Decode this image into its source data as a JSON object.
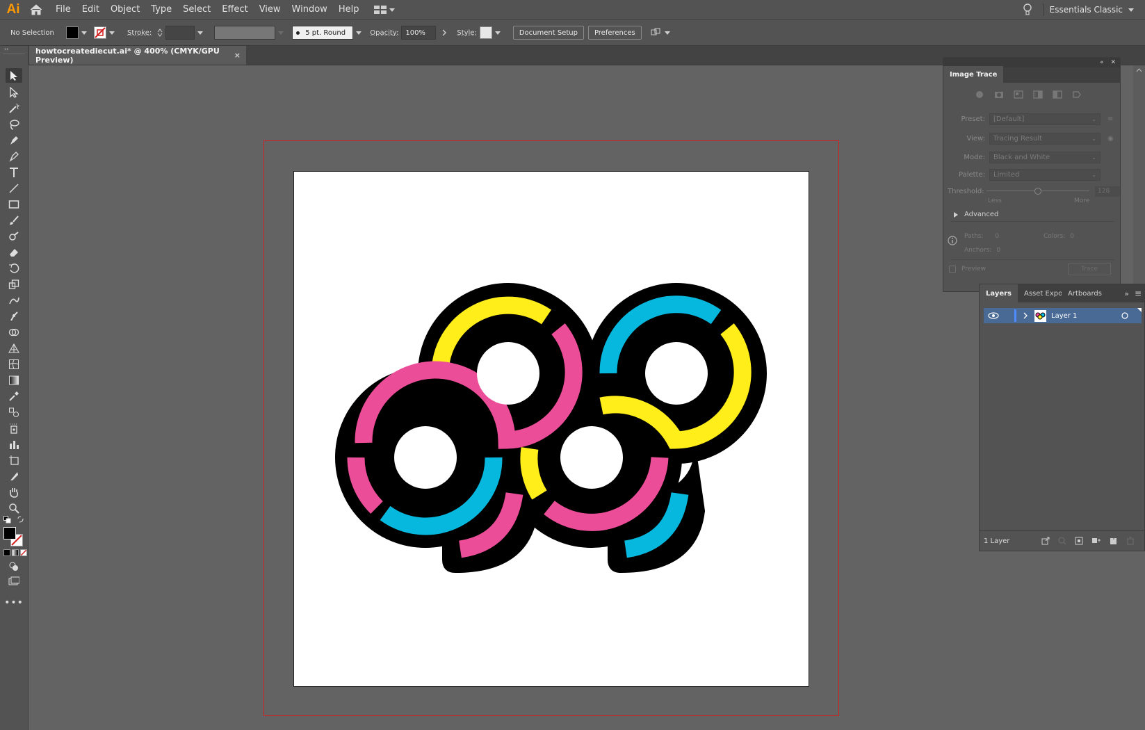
{
  "app": {
    "logo": "Ai",
    "workspace": "Essentials Classic"
  },
  "menu": [
    "File",
    "Edit",
    "Object",
    "Type",
    "Select",
    "Effect",
    "View",
    "Window",
    "Help"
  ],
  "control": {
    "selection": "No Selection",
    "stroke_label": "Stroke:",
    "brush": "5 pt. Round",
    "opacity_label": "Opacity:",
    "opacity_value": "100%",
    "style_label": "Style:",
    "document_setup": "Document Setup",
    "preferences": "Preferences"
  },
  "document": {
    "tab_title": "howtocreatediecut.ai* @ 400% (CMYK/GPU Preview)",
    "close": "×"
  },
  "image_trace": {
    "title": "Image Trace",
    "preset_label": "Preset:",
    "preset_value": "[Default]",
    "view_label": "View:",
    "view_value": "Tracing Result",
    "mode_label": "Mode:",
    "mode_value": "Black and White",
    "palette_label": "Palette:",
    "palette_value": "Limited",
    "threshold_label": "Threshold:",
    "threshold_value": "128",
    "less": "Less",
    "more": "More",
    "advanced": "Advanced",
    "paths_label": "Paths:",
    "paths_value": "0",
    "colors_label": "Colors:",
    "colors_value": "0",
    "anchors_label": "Anchors:",
    "anchors_value": "0",
    "preview_label": "Preview",
    "trace_button": "Trace"
  },
  "layers_panel": {
    "tabs": [
      "Layers",
      "Asset Export",
      "Artboards"
    ],
    "layer_name": "Layer 1",
    "count": "1 Layer"
  },
  "colors": {
    "accent_red": "#d21f1f",
    "pink": "#ec4d98",
    "yellow": "#ffee1a",
    "cyan": "#07b8de",
    "layer_blue": "#4a6a96"
  }
}
